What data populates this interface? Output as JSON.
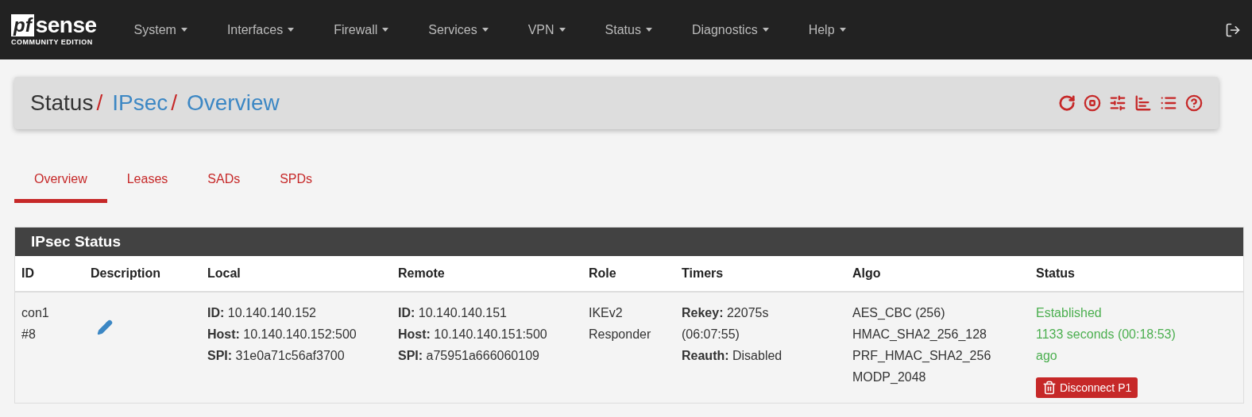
{
  "navbar": {
    "logo": {
      "mark": "pf",
      "word": "sense",
      "edition": "COMMUNITY EDITION"
    },
    "menu": [
      "System",
      "Interfaces",
      "Firewall",
      "Services",
      "VPN",
      "Status",
      "Diagnostics",
      "Help"
    ]
  },
  "breadcrumb": [
    {
      "label": "Status",
      "kind": "plain",
      "separator": "/"
    },
    {
      "label": "IPsec",
      "kind": "link",
      "separator": "/"
    },
    {
      "label": "Overview",
      "kind": "link"
    }
  ],
  "tabs": [
    {
      "label": "Overview",
      "selected": true
    },
    {
      "label": "Leases",
      "selected": false
    },
    {
      "label": "SADs",
      "selected": false
    },
    {
      "label": "SPDs",
      "selected": false
    }
  ],
  "panel": {
    "title": "IPsec Status",
    "columns": [
      "ID",
      "Description",
      "Local",
      "Remote",
      "Role",
      "Timers",
      "Algo",
      "Status"
    ],
    "rows": [
      {
        "id": [
          "con1",
          "#8"
        ],
        "local": [
          "**ID:** 10.140.140.152",
          "**Host:** 10.140.140.152:500",
          "**SPI:** 31e0a71c56af3700"
        ],
        "remote": [
          "**ID:** 10.140.140.151",
          "**Host:** 10.140.140.151:500",
          "**SPI:** a75951a666060109"
        ],
        "role": [
          "IKEv2",
          "Responder"
        ],
        "timers": [
          "**Rekey:** 22075s",
          "(06:07:55)",
          "**Reauth:** Disabled"
        ],
        "algo": [
          "AES_CBC (256)",
          "HMAC_SHA2_256_128",
          "PRF_HMAC_SHA2_256",
          "MODP_2048"
        ],
        "status": [
          "Established",
          "1133 seconds (00:18:53)",
          "ago"
        ],
        "action": "Disconnect P1"
      }
    ]
  }
}
